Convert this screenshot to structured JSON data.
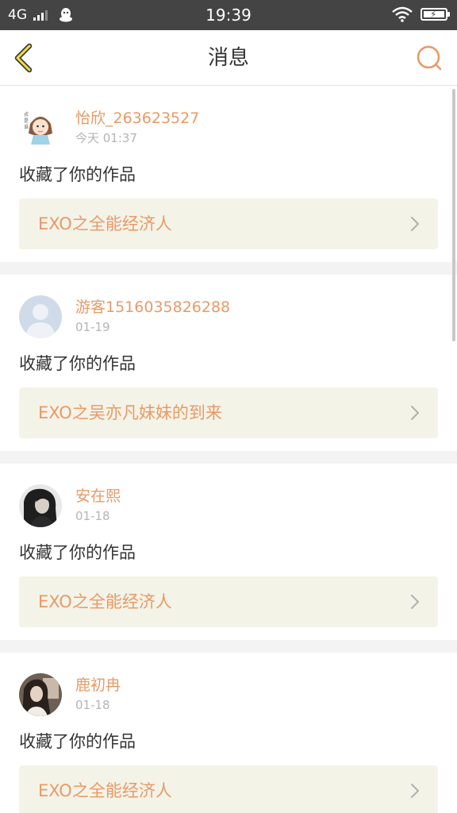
{
  "status_bar": {
    "network": "4G",
    "time": "19:39"
  },
  "header": {
    "title": "消息",
    "back_icon": "back-chevron-icon",
    "search_icon": "search-icon",
    "accent_color": "#e89a66"
  },
  "messages": [
    {
      "username": "怡欣_263623527",
      "timestamp": "今天 01:37",
      "action": "收藏了你的作品",
      "work_title": "EXO之全能经济人",
      "avatar": "cartoon-girl-avatar"
    },
    {
      "username": "游客1516035826288",
      "timestamp": "01-19",
      "action": "收藏了你的作品",
      "work_title": "EXO之吴亦凡妹妹的到来",
      "avatar": "default-guest-avatar"
    },
    {
      "username": "安在熙",
      "timestamp": "01-18",
      "action": "收藏了你的作品",
      "work_title": "EXO之全能经济人",
      "avatar": "photo-avatar"
    },
    {
      "username": "鹿初冉",
      "timestamp": "01-18",
      "action": "收藏了你的作品",
      "work_title": "EXO之全能经济人",
      "avatar": "photo-avatar"
    }
  ]
}
